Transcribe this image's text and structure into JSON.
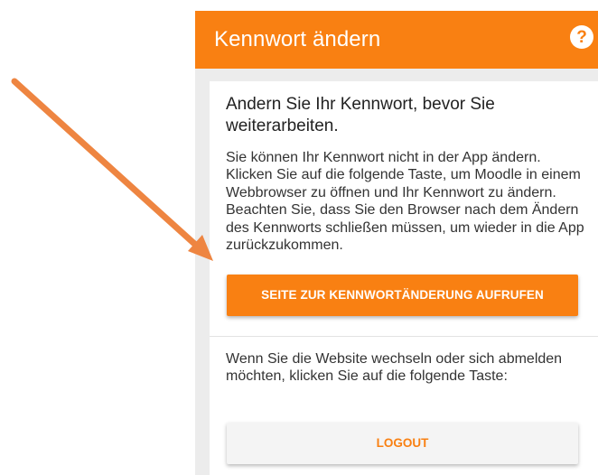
{
  "header": {
    "title": "Kennwort ändern",
    "help_icon": "help-icon",
    "help_glyph": "?"
  },
  "card": {
    "heading": "Andern Sie Ihr Kennwort, bevor Sie weiterarbeiten.",
    "body": "Sie können Ihr Kennwort nicht in der App ändern. Klicken Sie auf die folgende Taste, um Moodle in einem Webbrowser zu öffnen und Ihr Kennwort zu ändern. Beachten Sie, dass Sie den Browser nach dem Ändern des Kennworts schließen müssen, um wieder in die App zurückzukommen.",
    "primary_button": "SEITE ZUR KENNWORTÄNDERUNG AUFRUFEN",
    "logout_text": "Wenn Sie die Website wechseln oder sich abmelden möchten, klicken Sie auf die folgende Taste:",
    "logout_button": "LOGOUT"
  },
  "colors": {
    "accent": "#f98012",
    "annotation_arrow": "#ee8541",
    "background": "#ececec",
    "card": "#ffffff"
  }
}
